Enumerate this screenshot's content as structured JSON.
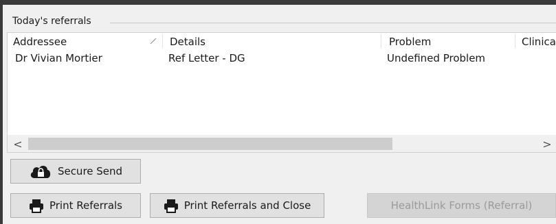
{
  "panel": {
    "title": "Today's referrals"
  },
  "columns": [
    "Addressee",
    "Details",
    "Problem",
    "Clinica"
  ],
  "rows": [
    {
      "addressee": "Dr Vivian Mortier",
      "details": "Ref Letter - DG",
      "problem": "Undefined Problem",
      "clinical": ""
    }
  ],
  "scroll": {
    "left_arrow": "<",
    "right_arrow": ">"
  },
  "buttons": {
    "secure_send": "Secure Send",
    "print_referrals": "Print Referrals",
    "print_and_close": "Print Referrals and Close",
    "healthlink": "HealthLink Forms (Referral)"
  },
  "colors": {
    "disabled_text": "#9a9a9a",
    "button_face": "#e1e1e1"
  }
}
